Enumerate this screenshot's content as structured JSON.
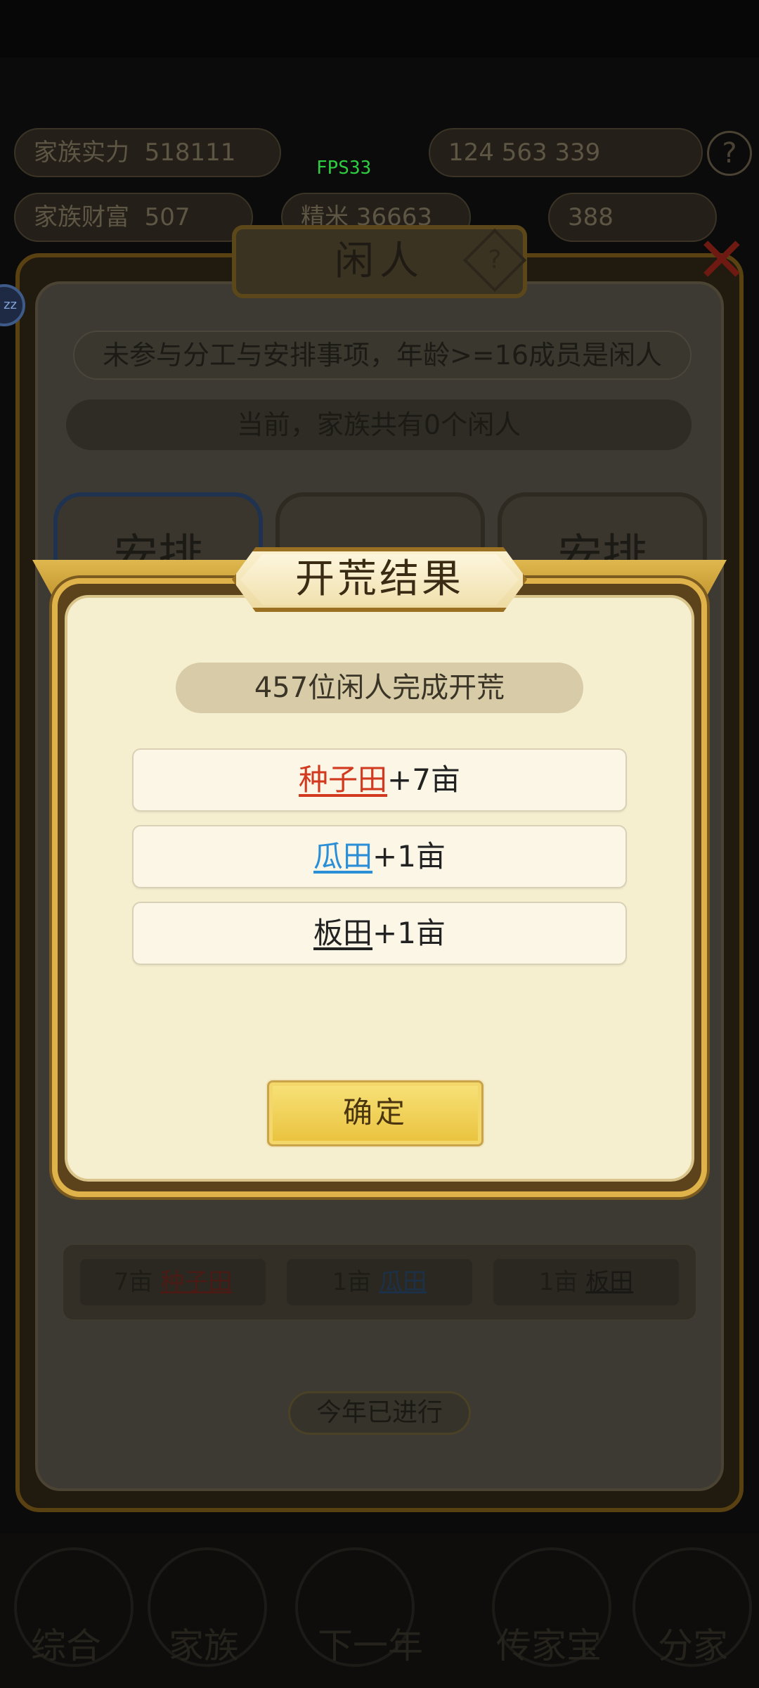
{
  "fps": "FPS33",
  "background": {
    "hud": {
      "row1_left_label": "家族实力",
      "row1_left_value": "518111",
      "row1_right_values": "124  563  339",
      "row2_left_label": "家族财富",
      "row2_left_value": "507",
      "row2_mid": "精米 36663",
      "row2_right_value": "388"
    },
    "panel_title": "闲人",
    "help_icon": "?",
    "rule_text": "未参与分工与安排事项，年龄>=16成员是闲人",
    "count_text": "当前，家族共有0个闲人",
    "slot_label": "安排",
    "tallies": [
      {
        "amount": "7亩 ",
        "field": "种子田",
        "color": "red"
      },
      {
        "amount": "1亩 ",
        "field": "瓜田",
        "color": "blue"
      },
      {
        "amount": "1亩 ",
        "field": "板田",
        "color": "black"
      }
    ],
    "year_status": "今年已进行",
    "nav": [
      "综合",
      "家族",
      "下一年",
      "传家宝",
      "分家"
    ]
  },
  "dialog": {
    "title": "开荒结果",
    "summary": "457位闲人完成开荒",
    "results": [
      {
        "field": "种子田",
        "gain": "+7亩",
        "color": "#d23a1f"
      },
      {
        "field": "瓜田",
        "gain": "+1亩",
        "color": "#2a8fd6"
      },
      {
        "field": "板田",
        "gain": "+1亩",
        "color": "#222222"
      }
    ],
    "confirm_label": "确定"
  }
}
